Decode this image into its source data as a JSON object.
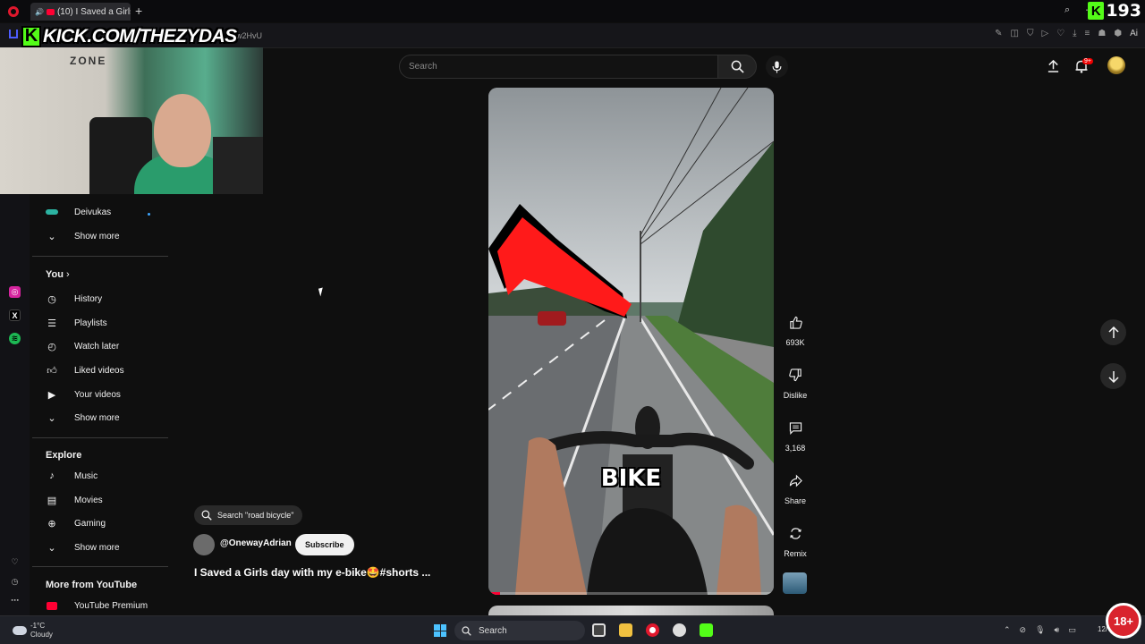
{
  "browser": {
    "tab_title": "(10) I Saved a Girls da",
    "new_tab_label": "+",
    "url_tail": "Ew2HvU",
    "ai_label": "Ai",
    "kick_counter": "193",
    "kick_logo": "K"
  },
  "stream_overlay": {
    "kick_url": "KICK.COM/THEZYDAS",
    "kick_logo": "K",
    "wall_text": "ZONE"
  },
  "search": {
    "placeholder": "Search"
  },
  "header": {
    "notifications_badge": "9+"
  },
  "guide": {
    "subscription_item": "Deivukas",
    "show_more_1": "Show more",
    "you_heading": "You",
    "you_items": [
      "History",
      "Playlists",
      "Watch later",
      "Liked videos",
      "Your videos"
    ],
    "show_more_2": "Show more",
    "explore_heading": "Explore",
    "explore_items": [
      "Music",
      "Movies",
      "Gaming"
    ],
    "show_more_3": "Show more",
    "more_heading": "More from YouTube",
    "more_items": [
      "YouTube Premium"
    ]
  },
  "short": {
    "caption": "BIKE",
    "progress_fraction": 0.04,
    "search_chip": "Search \"road bicycle\"",
    "channel": "@OnewayAdrian",
    "subscribe_label": "Subscribe",
    "title": "I Saved a Girls day with my e-bike🤩#shorts ..."
  },
  "actions": {
    "likes": "693K",
    "dislike_label": "Dislike",
    "comments": "3,168",
    "share_label": "Share",
    "remix_label": "Remix"
  },
  "taskbar": {
    "temperature": "-1°C",
    "weather": "Cloudy",
    "search_label": "Search",
    "date_fragment": "12/",
    "age_badge": "18+"
  },
  "colors": {
    "youtube_red": "#ff0033",
    "kick_green": "#53fc18",
    "background": "#0f0f0f"
  }
}
